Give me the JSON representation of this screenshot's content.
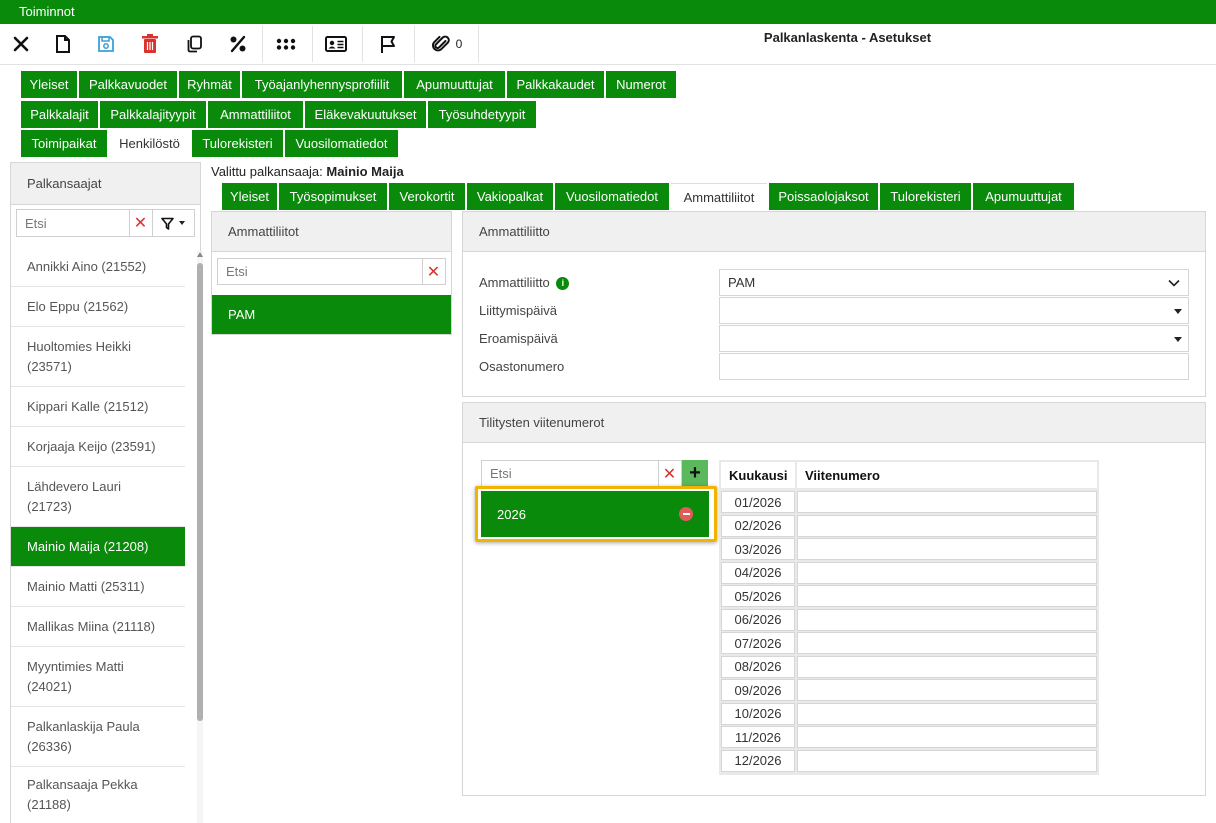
{
  "app": {
    "menu_title": "Toiminnot",
    "page_title": "Palkanlaskenta - Asetukset"
  },
  "toolbar": {
    "buttons": [
      {
        "name": "close-icon"
      },
      {
        "name": "new-file-icon"
      },
      {
        "name": "save-icon"
      },
      {
        "name": "delete-icon"
      },
      {
        "name": "copy-icon"
      },
      {
        "name": "percent-icon"
      },
      {
        "name": "apps-icon"
      },
      {
        "name": "id-card-icon"
      },
      {
        "name": "flag-icon"
      },
      {
        "name": "attachment-icon"
      }
    ],
    "attachment_count": "0"
  },
  "main_tabs": {
    "row1": [
      "Yleiset",
      "Palkkavuodet",
      "Ryhmät",
      "Työajanlyhennysprofiilit",
      "Apumuuttujat",
      "Palkkakaudet",
      "Numerot"
    ],
    "row2": [
      "Palkkalajit",
      "Palkkalajityypit",
      "Ammattiliitot",
      "Eläkevakuutukset",
      "Työsuhdetyypit"
    ],
    "row3": [
      "Toimipaikat",
      "Henkilöstö",
      "Tulorekisteri",
      "Vuosilomatiedot"
    ],
    "active": "Henkilöstö"
  },
  "employees_panel": {
    "title": "Palkansaajat",
    "search_placeholder": "Etsi",
    "items": [
      "Annikki Aino (21552)",
      "Elo Eppu (21562)",
      "Huoltomies Heikki (23571)",
      "Kippari Kalle (21512)",
      "Korjaaja Keijo (23591)",
      "Lähdevero Lauri (21723)",
      "Mainio Maija (21208)",
      "Mainio Matti (25311)",
      "Mallikas Miina (21118)",
      "Myyntimies Matti (24021)",
      "Palkanlaskija Paula (26336)",
      "Palkansaaja Pekka (21188)"
    ],
    "selected": "Mainio Maija (21208)"
  },
  "selected_employee": {
    "label": "Valittu palkansaaja:",
    "name": "Mainio Maija"
  },
  "sub_tabs": {
    "items": [
      "Yleiset",
      "Työsopimukset",
      "Verokortit",
      "Vakiopalkat",
      "Vuosilomatiedot",
      "Ammattiliitot",
      "Poissaolojaksot",
      "Tulorekisteri",
      "Apumuuttujat"
    ],
    "active": "Ammattiliitot"
  },
  "unions_panel": {
    "title": "Ammattiliitot",
    "search_placeholder": "Etsi",
    "items": [
      "PAM"
    ],
    "selected": "PAM"
  },
  "union_details": {
    "title": "Ammattiliitto",
    "fields": [
      {
        "label": "Ammattiliitto",
        "value": "PAM",
        "info": "i"
      },
      {
        "label": "Liittymispäivä",
        "value": ""
      },
      {
        "label": "Eroamispäivä",
        "value": ""
      },
      {
        "label": "Osastonumero",
        "value": ""
      }
    ]
  },
  "reference_numbers": {
    "title": "Tilitysten viitenumerot",
    "search_placeholder": "Etsi",
    "add_label": "+",
    "years": [
      "2026"
    ],
    "selected_year": "2026",
    "table": {
      "headers": [
        "Kuukausi",
        "Viitenumero"
      ],
      "rows": [
        {
          "month": "01/2026",
          "ref": ""
        },
        {
          "month": "02/2026",
          "ref": ""
        },
        {
          "month": "03/2026",
          "ref": ""
        },
        {
          "month": "04/2026",
          "ref": ""
        },
        {
          "month": "05/2026",
          "ref": ""
        },
        {
          "month": "06/2026",
          "ref": ""
        },
        {
          "month": "07/2026",
          "ref": ""
        },
        {
          "month": "08/2026",
          "ref": ""
        },
        {
          "month": "09/2026",
          "ref": ""
        },
        {
          "month": "10/2026",
          "ref": ""
        },
        {
          "month": "11/2026",
          "ref": ""
        },
        {
          "month": "12/2026",
          "ref": ""
        }
      ]
    }
  },
  "colors": {
    "green": "#0a8a0a",
    "red": "#d9332e",
    "blue": "#3da0d8",
    "highlight": "#f0b400"
  }
}
